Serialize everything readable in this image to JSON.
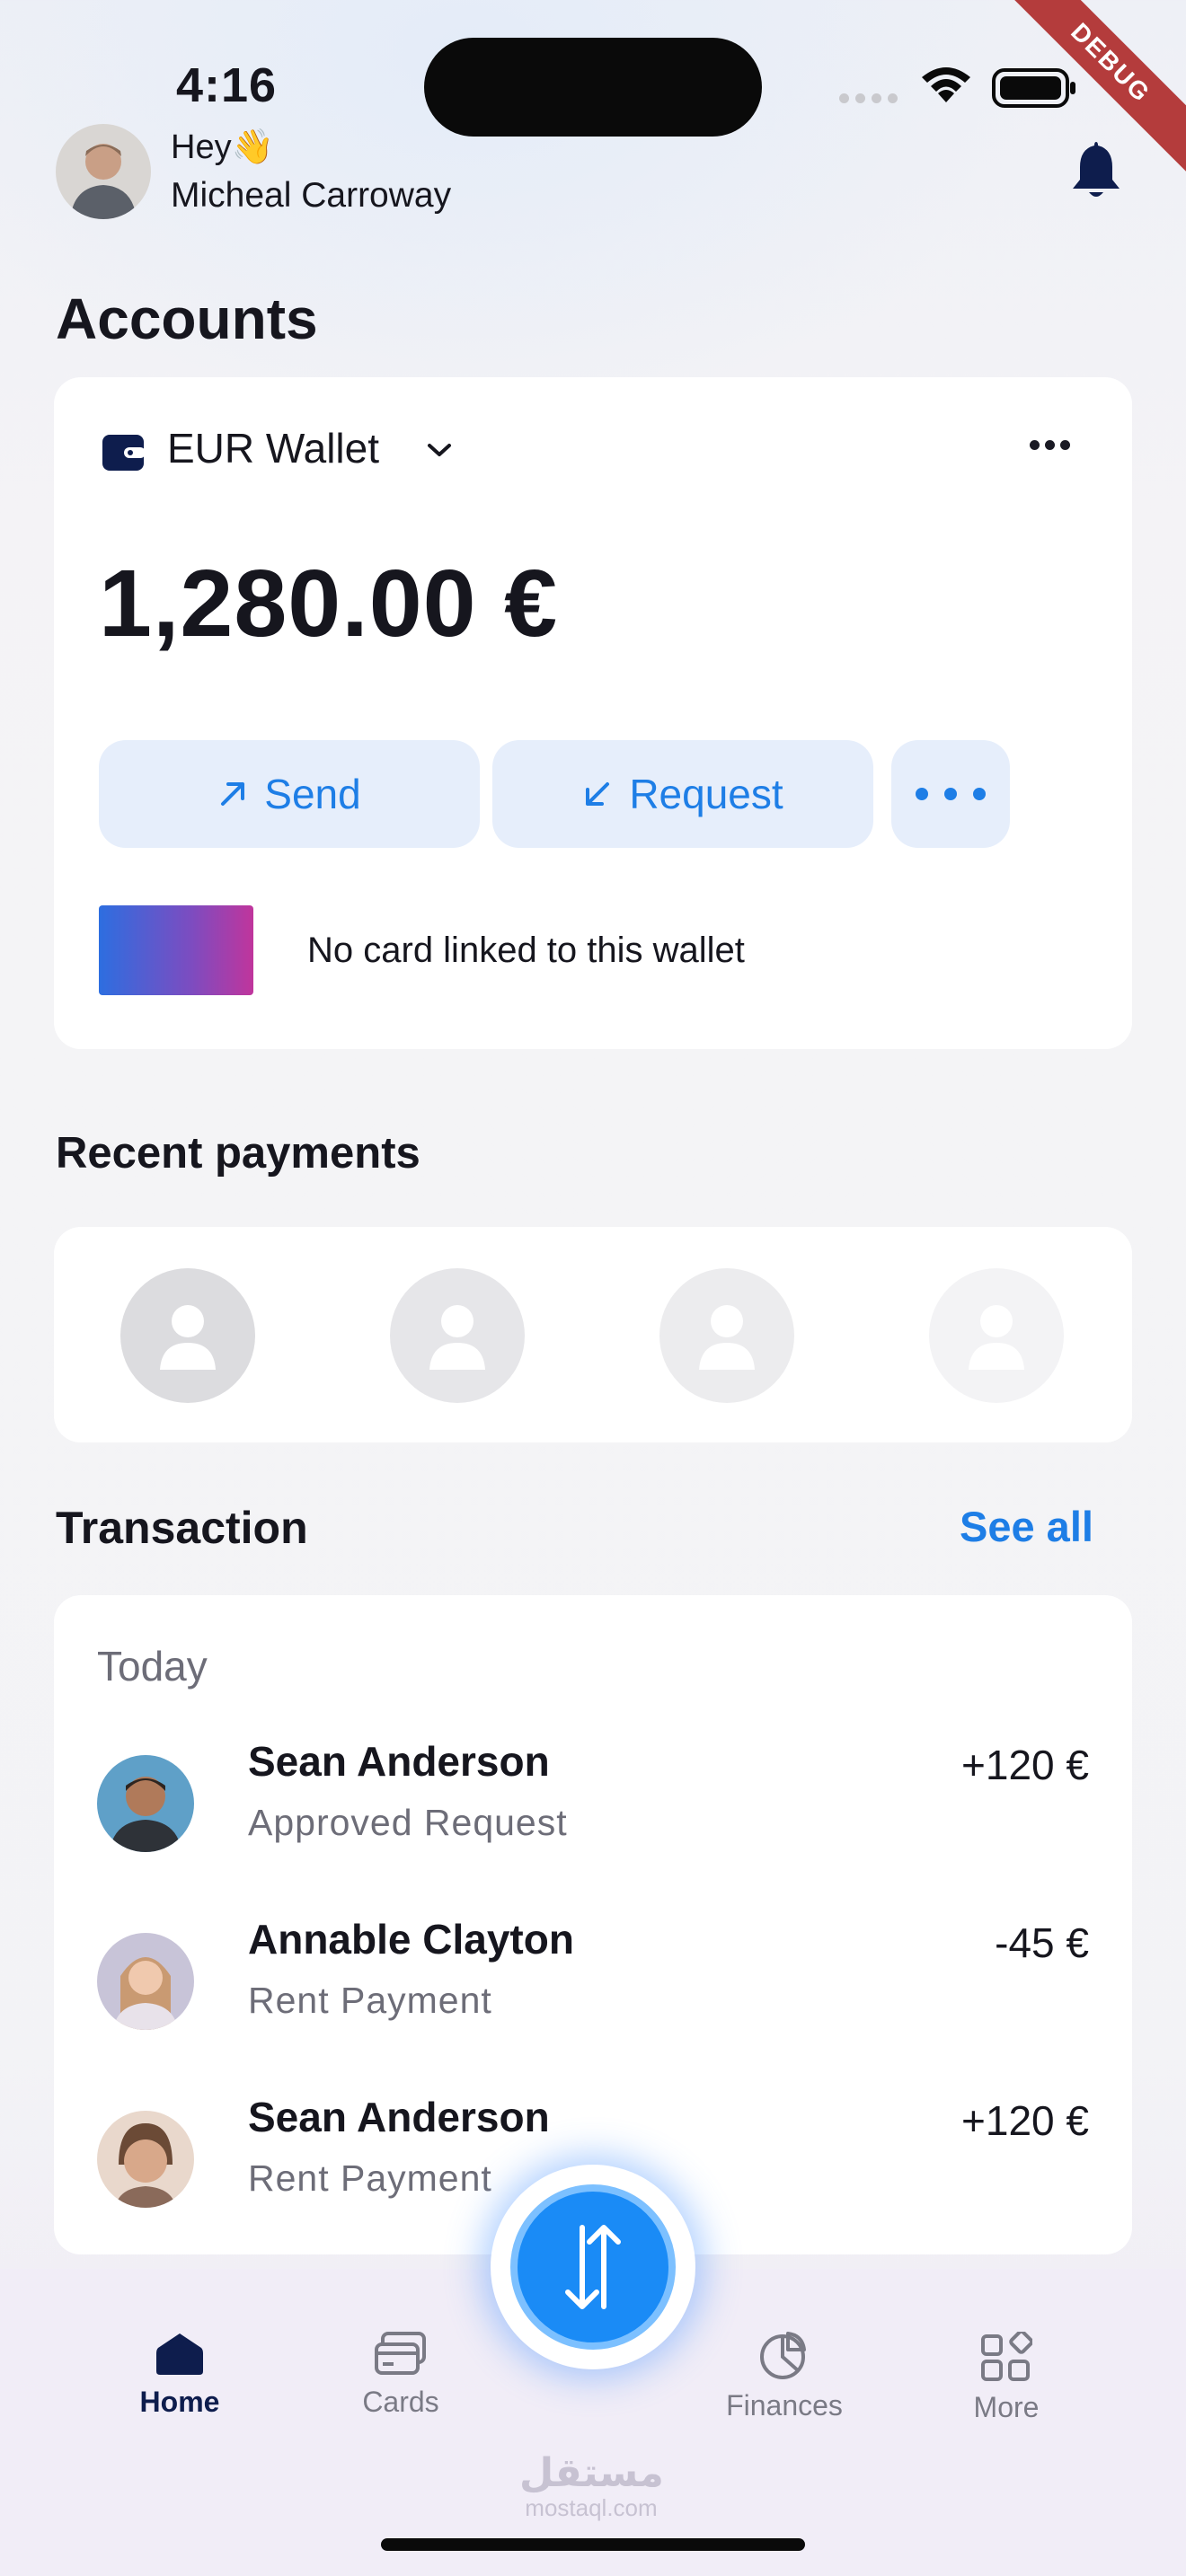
{
  "status_bar": {
    "time": "4:16",
    "debug_label": "DEBUG"
  },
  "header": {
    "greeting": "Hey👋",
    "user_name": "Micheal Carroway"
  },
  "accounts": {
    "title": "Accounts",
    "wallet_name": "EUR Wallet",
    "balance": "1,280.00 €",
    "send_label": "Send",
    "request_label": "Request",
    "no_card_text": "No card linked to this wallet"
  },
  "recent_payments": {
    "title": "Recent payments",
    "contacts_count": 4
  },
  "transactions": {
    "title": "Transaction",
    "see_all": "See all",
    "group_label": "Today",
    "items": [
      {
        "name": "Sean Anderson",
        "subtitle": "Approved Request",
        "amount": "+120 €"
      },
      {
        "name": "Annable Clayton",
        "subtitle": "Rent Payment",
        "amount": "-45 €"
      },
      {
        "name": "Sean Anderson",
        "subtitle": "Rent Payment",
        "amount": "+120 €"
      }
    ]
  },
  "nav": {
    "home": "Home",
    "cards": "Cards",
    "finances": "Finances",
    "more": "More"
  },
  "watermark": {
    "arabic": "مستقل",
    "latin": "mostaql.com"
  },
  "colors": {
    "accent": "#1e7ee6",
    "nav_active": "#0e1d4d",
    "fab": "#1a8bf6"
  }
}
